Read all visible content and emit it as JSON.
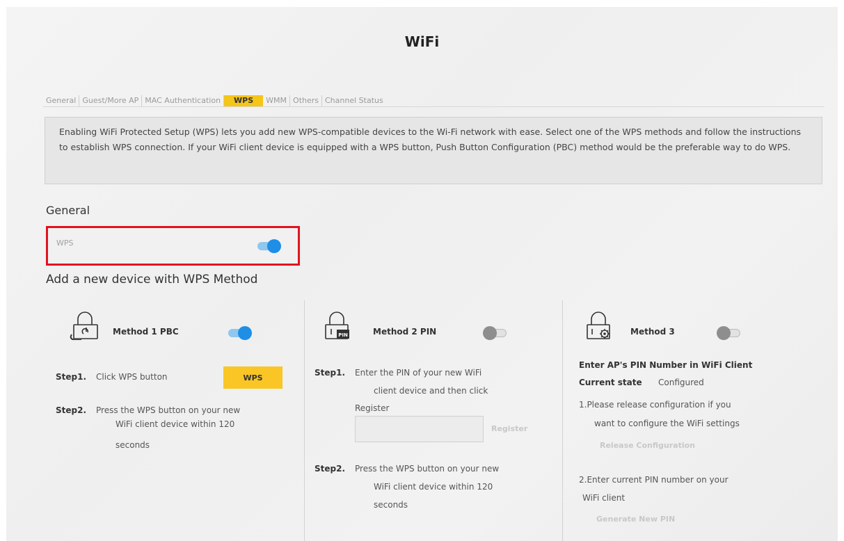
{
  "page": {
    "title": "WiFi"
  },
  "tabs": [
    {
      "label": "General"
    },
    {
      "label": "Guest/More AP"
    },
    {
      "label": "MAC Authentication"
    },
    {
      "label": "WPS",
      "active": true
    },
    {
      "label": "WMM"
    },
    {
      "label": "Others"
    },
    {
      "label": "Channel Status"
    }
  ],
  "intro": "Enabling WiFi Protected Setup (WPS) lets you add new WPS-compatible devices to the Wi-Fi network with ease. Select one of the WPS methods and follow the instructions to establish WPS connection. If your WiFi client device is equipped with a WPS button, Push Button Configuration (PBC) method would be the preferable way to do WPS.",
  "general": {
    "heading": "General",
    "wps_label": "WPS",
    "wps_enabled": true
  },
  "add_device": {
    "heading": "Add a new device with WPS Method"
  },
  "method1": {
    "title": "Method 1 PBC",
    "enabled": true,
    "step1_label": "Step1.",
    "step1_text": "Click WPS button",
    "wps_button": "WPS",
    "step2_label": "Step2.",
    "step2_lines": [
      "Press the WPS button on your new",
      "WiFi client device within 120",
      "seconds"
    ]
  },
  "method2": {
    "title": "Method 2 PIN",
    "enabled": false,
    "icon_badge": "PIN",
    "step1_label": "Step1.",
    "step1_lines": [
      "Enter the PIN of your new WiFi",
      "client device and then click",
      "Register"
    ],
    "pin_value": "",
    "register_button": "Register",
    "step2_label": "Step2.",
    "step2_lines": [
      "Press the WPS button on your new",
      "WiFi client device within 120",
      "seconds"
    ]
  },
  "method3": {
    "title": "Method 3",
    "enabled": false,
    "enter_pin_heading": "Enter AP's PIN Number in WiFi Client",
    "current_state_label": "Current state",
    "current_state_value": "Configured",
    "item1_lines": [
      "1.Please release configuration if you",
      "want to configure the WiFi settings"
    ],
    "release_button": "Release Configuration",
    "item2_lines": [
      "2.Enter current PIN number on your",
      "WiFi client"
    ],
    "generate_button": "Generate New PIN"
  },
  "colors": {
    "accent_yellow": "#f9c626",
    "toggle_on": "#1e8ee6",
    "highlight_red": "#e0141e"
  }
}
